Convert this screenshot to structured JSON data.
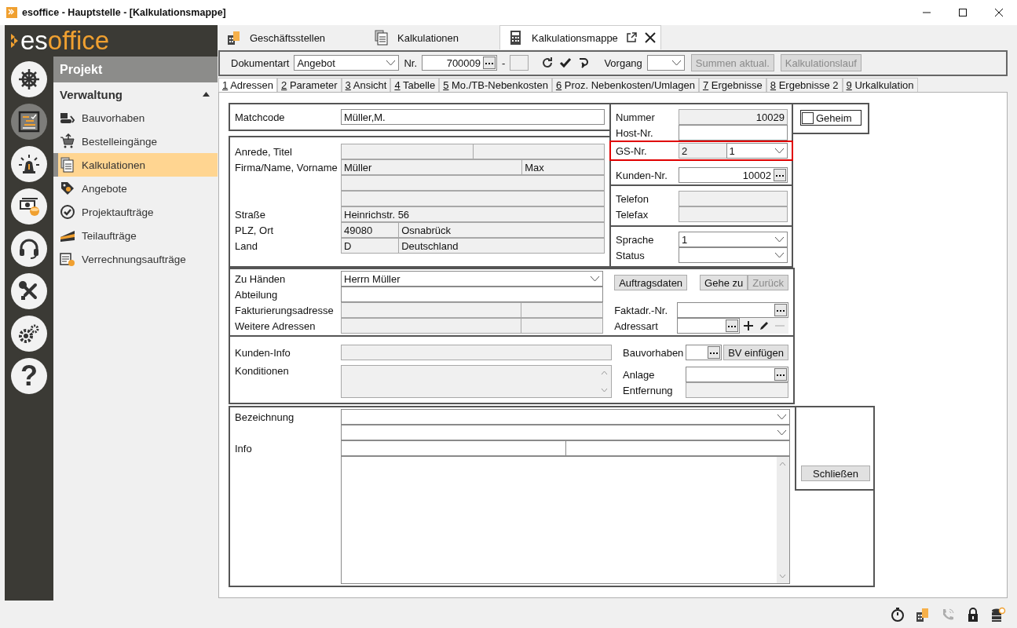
{
  "window": {
    "title": "esoffice - Hauptstelle - [Kalkulationsmappe]"
  },
  "logo": {
    "part_1": "es",
    "part_2": "office"
  },
  "rail": [
    {
      "kind": "helm",
      "selected": false
    },
    {
      "kind": "planner",
      "selected": true
    },
    {
      "kind": "alarm",
      "selected": false
    },
    {
      "kind": "money",
      "selected": false
    },
    {
      "kind": "headset",
      "selected": false
    },
    {
      "kind": "tools",
      "selected": false
    },
    {
      "kind": "gears",
      "selected": false
    },
    {
      "kind": "help",
      "glyph": "?",
      "selected": false
    }
  ],
  "sidebar": {
    "title": "Projekt",
    "group": {
      "label": "Verwaltung",
      "expanded": true
    },
    "items": [
      {
        "label": "Bauvorhaben",
        "kind": "excavator",
        "selected": false
      },
      {
        "label": "Bestelleingänge",
        "kind": "cart",
        "selected": false
      },
      {
        "label": "Kalkulationen",
        "kind": "documents",
        "selected": true
      },
      {
        "label": "Angebote",
        "kind": "tag",
        "selected": false
      },
      {
        "label": "Projektaufträge",
        "kind": "check",
        "selected": false
      },
      {
        "label": "Teilaufträge",
        "kind": "wedge",
        "selected": false
      },
      {
        "label": "Verrechnungsaufträge",
        "kind": "ledger",
        "selected": false
      }
    ]
  },
  "doc_tabs": [
    {
      "label": "Geschäftsstellen",
      "kind": "building",
      "selected": false,
      "closable": false
    },
    {
      "label": "Kalkulationen",
      "kind": "documents",
      "selected": false,
      "closable": false
    },
    {
      "label": "Kalkulationsmappe",
      "kind": "calculator",
      "selected": true,
      "closable": true
    }
  ],
  "toolbar": {
    "dokumentart": {
      "label": "Dokumentart",
      "value": "Angebot"
    },
    "nr": {
      "label": "Nr.",
      "value": "700009",
      "separator": "-"
    },
    "vorgang": {
      "label": "Vorgang"
    },
    "buttons": [
      {
        "label": "Summen aktual.",
        "disabled": true
      },
      {
        "label": "Kalkulationslauf",
        "disabled": true
      }
    ]
  },
  "form_tabs": [
    {
      "key": "1",
      "label": "Adressen",
      "selected": true
    },
    {
      "key": "2",
      "label": "Parameter",
      "selected": false
    },
    {
      "key": "3",
      "label": "Ansicht",
      "selected": false
    },
    {
      "key": "4",
      "label": "Tabelle",
      "selected": false
    },
    {
      "key": "5",
      "label": "Mo./TB-Nebenkosten",
      "selected": false
    },
    {
      "key": "6",
      "label": "Proz. Nebenkosten/Umlagen",
      "selected": false
    },
    {
      "key": "7",
      "label": "Ergebnisse",
      "selected": false
    },
    {
      "key": "8",
      "label": "Ergebnisse 2",
      "selected": false
    },
    {
      "key": "9",
      "label": "Urkalkulation",
      "selected": false
    }
  ],
  "form": {
    "matchcode": [
      {
        "label": "Matchcode",
        "fields": [
          {
            "kind": "text",
            "value": "Müller,M.",
            "disabled": false
          }
        ]
      }
    ],
    "address": [
      {
        "label": "Anrede, Titel",
        "fields": [
          {
            "kind": "text",
            "disabled": true
          },
          {
            "kind": "text",
            "disabled": true
          }
        ]
      },
      {
        "label": "Firma/Name, Vorname",
        "fields": [
          {
            "kind": "text",
            "value": "Müller",
            "disabled": true
          },
          {
            "kind": "text",
            "value": "Max",
            "disabled": true
          }
        ]
      },
      {
        "fields": [
          {
            "kind": "text",
            "disabled": true
          }
        ]
      },
      {
        "fields": [
          {
            "kind": "text",
            "disabled": true
          }
        ]
      },
      {
        "label": "Straße",
        "fields": [
          {
            "kind": "text",
            "value": "Heinrichstr. 56",
            "disabled": true
          }
        ]
      },
      {
        "label": "PLZ, Ort",
        "fields": [
          {
            "kind": "text",
            "value": "49080",
            "disabled": true
          },
          {
            "kind": "text",
            "value": "Osnabrück",
            "disabled": true
          }
        ]
      },
      {
        "label": "Land",
        "fields": [
          {
            "kind": "text",
            "value": "D",
            "disabled": true
          },
          {
            "kind": "text",
            "value": "Deutschland",
            "disabled": true
          }
        ]
      }
    ],
    "ids": [
      {
        "label": "Nummer",
        "highlighted": false,
        "fields": [
          {
            "kind": "number",
            "value": "10029",
            "disabled": true
          }
        ]
      },
      {
        "label": "Host-Nr.",
        "highlighted": false,
        "fields": [
          {
            "kind": "text",
            "disabled": false
          }
        ]
      },
      {
        "label": "GS-Nr.",
        "highlighted": true,
        "fields": [
          {
            "kind": "text",
            "value": "2",
            "disabled": true
          },
          {
            "kind": "combo",
            "value": "1",
            "disabled": false
          }
        ]
      },
      {
        "label": "Kunden-Nr.",
        "highlighted": false,
        "fields": [
          {
            "kind": "lookup",
            "value": "10002",
            "disabled": false
          }
        ]
      }
    ],
    "contact": [
      {
        "label": "Telefon",
        "fields": [
          {
            "kind": "text",
            "disabled": true
          }
        ]
      },
      {
        "label": "Telefax",
        "fields": [
          {
            "kind": "text",
            "disabled": true
          }
        ]
      }
    ],
    "language": [
      {
        "label": "Sprache",
        "fields": [
          {
            "kind": "combo",
            "value": "1",
            "disabled": false
          }
        ]
      },
      {
        "label": "Status",
        "fields": [
          {
            "kind": "combo",
            "disabled": false
          }
        ]
      }
    ],
    "geheim": {
      "label": "Geheim",
      "checked": false
    },
    "recipient": [
      {
        "label": "Zu Händen",
        "fields": [
          {
            "kind": "combo",
            "value": "Herrn Müller",
            "disabled": false
          }
        ]
      },
      {
        "label": "Abteilung",
        "fields": [
          {
            "kind": "text",
            "disabled": false
          }
        ]
      },
      {
        "label": "Fakturierungsadresse",
        "fields": [
          {
            "kind": "text",
            "disabled": true
          },
          {
            "kind": "text",
            "disabled": true
          }
        ]
      },
      {
        "label": "Weitere Adressen",
        "fields": [
          {
            "kind": "text",
            "disabled": true
          },
          {
            "kind": "text",
            "disabled": true
          }
        ]
      }
    ],
    "recipient_side": {
      "buttons": [
        {
          "label": "Auftragsdaten",
          "disabled": false
        },
        {
          "label": "Gehe zu",
          "disabled": false
        },
        {
          "label": "Zurück",
          "disabled": true
        }
      ],
      "rows": [
        {
          "label": "Faktadr.-Nr.",
          "fields": [
            {
              "kind": "lookup",
              "disabled": false
            }
          ]
        },
        {
          "label": "Adressart",
          "fields": [
            {
              "kind": "lookup",
              "disabled": false
            }
          ],
          "actions": [
            {
              "kind": "add",
              "disabled": false
            },
            {
              "kind": "edit",
              "disabled": false
            },
            {
              "kind": "remove",
              "disabled": true
            }
          ]
        }
      ]
    },
    "customer": [
      {
        "label": "Kunden-Info",
        "fields": [
          {
            "kind": "text",
            "disabled": true
          }
        ]
      },
      {
        "label": "Konditionen",
        "fields": [
          {
            "kind": "area",
            "disabled": true
          }
        ]
      }
    ],
    "customer_side": [
      {
        "label": "Bauvorhaben",
        "fields": [
          {
            "kind": "lookup",
            "disabled": false
          }
        ],
        "button": {
          "label": "BV einfügen",
          "disabled": false
        }
      },
      {
        "label": "Anlage",
        "fields": [
          {
            "kind": "lookup",
            "disabled": false
          }
        ]
      },
      {
        "label": "Entfernung",
        "fields": [
          {
            "kind": "text",
            "disabled": true
          }
        ]
      }
    ],
    "description": [
      {
        "label": "Bezeichnung",
        "fields": [
          {
            "kind": "combo",
            "disabled": false
          }
        ]
      },
      {
        "fields": [
          {
            "kind": "combo",
            "disabled": false
          }
        ]
      },
      {
        "label": "Info",
        "fields": [
          {
            "kind": "text",
            "disabled": false
          },
          {
            "kind": "text",
            "disabled": false
          }
        ]
      },
      {
        "fields": [
          {
            "kind": "area",
            "disabled": false
          }
        ]
      }
    ],
    "close_button": {
      "label": "Schließen"
    }
  },
  "status_icons": [
    {
      "kind": "stopwatch",
      "disabled": false
    },
    {
      "kind": "building",
      "disabled": false
    },
    {
      "kind": "phone",
      "disabled": true
    },
    {
      "kind": "lock",
      "disabled": false
    },
    {
      "kind": "database",
      "disabled": false
    }
  ]
}
